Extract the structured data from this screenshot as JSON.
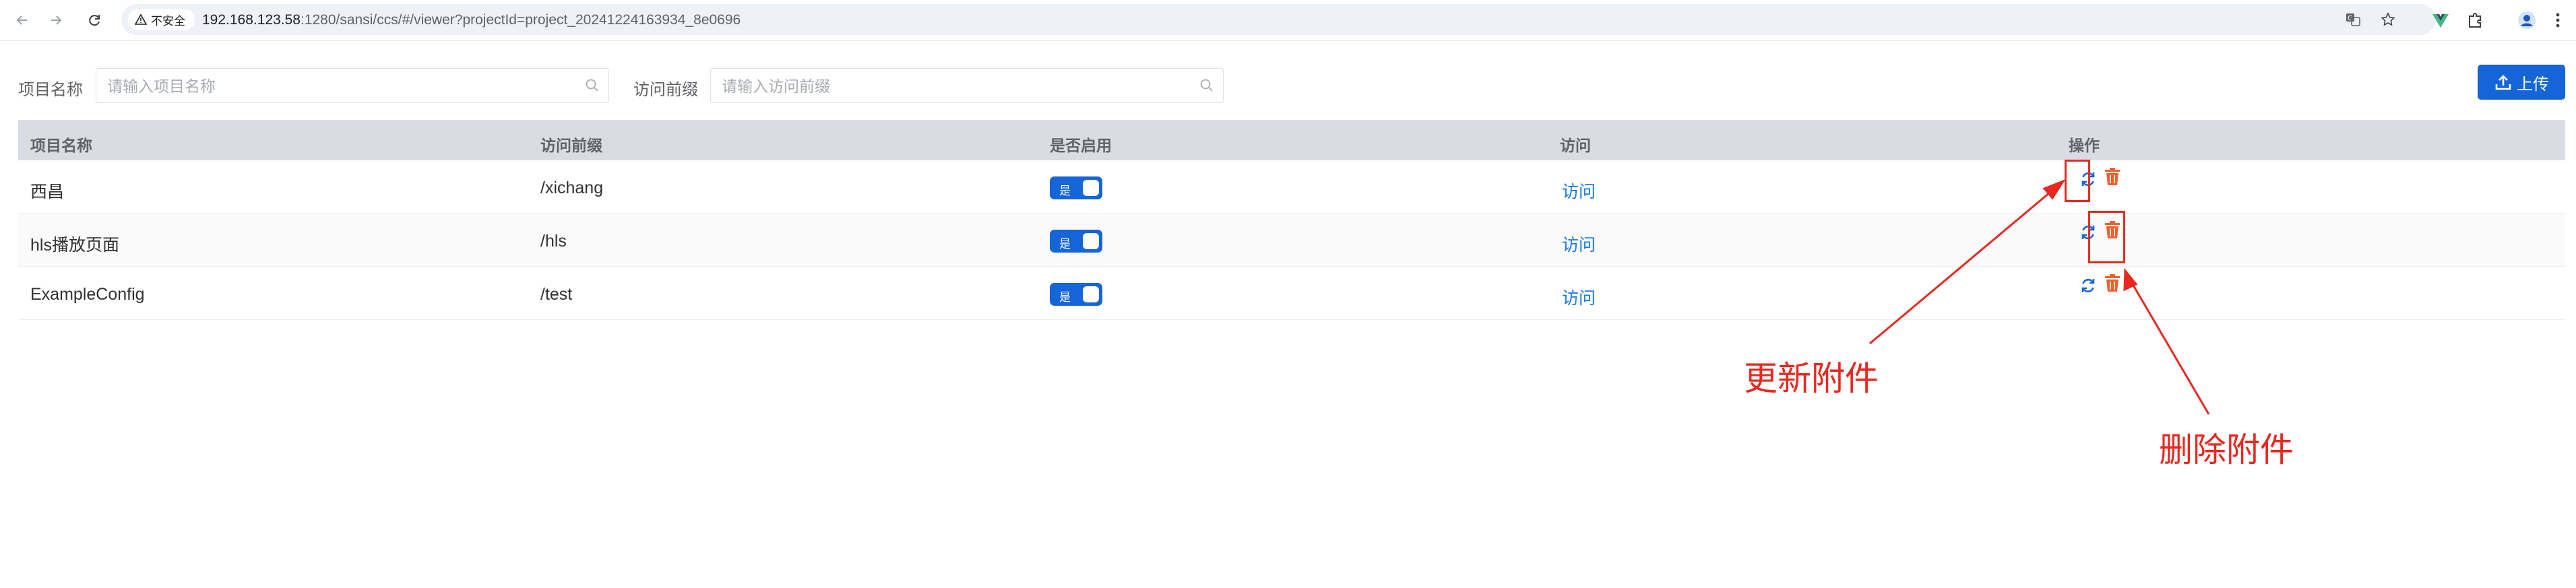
{
  "browser": {
    "security_chip": "不安全",
    "url_host": "192.168.123.58",
    "url_rest": ":1280/sansi/ccs/#/viewer?projectId=project_20241224163934_8e0696"
  },
  "search": {
    "project_name_label": "项目名称",
    "project_name_placeholder": "请输入项目名称",
    "prefix_label": "访问前缀",
    "prefix_placeholder": "请输入访问前缀"
  },
  "toolbar": {
    "upload_label": "上传"
  },
  "table": {
    "headers": [
      "项目名称",
      "访问前缀",
      "是否启用",
      "访问",
      "操作"
    ],
    "rows": [
      {
        "name": "西昌",
        "prefix": "/xichang",
        "enabled": true,
        "switch_text": "是",
        "visit": "访问"
      },
      {
        "name": "hls播放页面",
        "prefix": "/hls",
        "enabled": true,
        "switch_text": "是",
        "visit": "访问"
      },
      {
        "name": "ExampleConfig",
        "prefix": "/test",
        "enabled": true,
        "switch_text": "是",
        "visit": "访问"
      }
    ]
  },
  "annotations": {
    "update_attachment": "更新附件",
    "delete_attachment": "删除附件"
  },
  "colors": {
    "primary": "#1565d8",
    "link": "#1b7bdc",
    "refresh_icon": "#1565d8",
    "delete_icon": "#f0602e",
    "annotation": "#e8281f",
    "header_bg": "#d9dce3"
  },
  "icons": [
    "back-icon",
    "forward-icon",
    "reload-icon",
    "warning-icon",
    "translate-icon",
    "star-icon",
    "vue-devtools-icon",
    "extensions-icon",
    "profile-icon",
    "menu-icon",
    "search-icon",
    "upload-icon",
    "refresh-icon",
    "trash-icon"
  ]
}
